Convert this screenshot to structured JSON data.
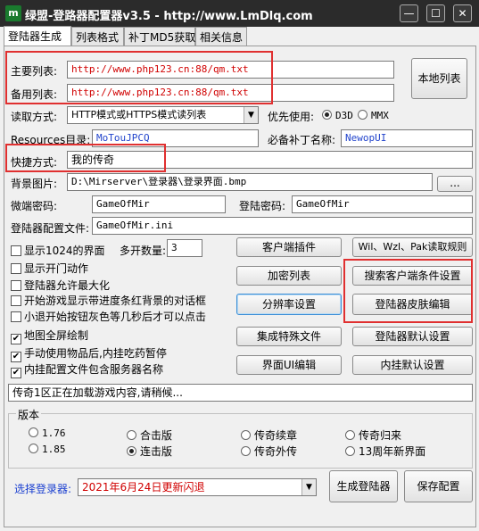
{
  "window": {
    "title": "绿盟-登路器配置器v3.5 - http://www.LmDlq.com",
    "icon_letter": "m",
    "minimize": "—",
    "maximize": "☐",
    "close": "✕"
  },
  "tabs": [
    {
      "label": "登陆器生成"
    },
    {
      "label": "列表格式"
    },
    {
      "label": "补丁MD5获取"
    },
    {
      "label": "相关信息"
    }
  ],
  "form": {
    "main_list_label": "主要列表:",
    "main_list_value": "http://www.php123.cn:88/qm.txt",
    "backup_list_label": "备用列表:",
    "backup_list_value": "http://www.php123.cn:88/qm.txt",
    "local_list_button": "本地列表",
    "read_mode_label": "读取方式:",
    "read_mode_value": "HTTP模式或HTTPS模式读列表",
    "priority_label": "优先使用:",
    "priority_d3d": "D3D",
    "priority_mmx": "MMX",
    "resources_label": "Resources目录:",
    "resources_value": "MoTouJPCQ",
    "patch_label": "必备补丁名称:",
    "patch_value": "NewopUI",
    "shortcut_label": "快捷方式:",
    "shortcut_value": "我的传奇",
    "bg_label": "背景图片:",
    "bg_value": "D:\\Mirserver\\登录器\\登录界面.bmp",
    "browse_button": "...",
    "micro_pwd_label": "微端密码:",
    "micro_pwd_value": "GameOfMir",
    "login_pwd_label": "登陆密码:",
    "login_pwd_value": "GameOfMir",
    "config_file_label": "登陆器配置文件:",
    "config_file_value": "GameOfMir.ini",
    "multi_count_label": "多开数量:",
    "multi_count_value": "3"
  },
  "checkboxes": [
    {
      "label": "显示1024的界面",
      "checked": false
    },
    {
      "label": "显示开门动作",
      "checked": false
    },
    {
      "label": "登陆器允许最大化",
      "checked": false
    },
    {
      "label": "开始游戏显示带进度条红背景的对话框",
      "checked": false
    },
    {
      "label": "小退开始按钮灰色等几秒后才可以点击",
      "checked": false
    },
    {
      "label": "地图全屏绘制",
      "checked": true
    },
    {
      "label": "手动使用物品后,内挂吃药暂停",
      "checked": true
    },
    {
      "label": "内挂配置文件包含服务器名称",
      "checked": true
    }
  ],
  "buttons": {
    "client_plugin": "客户端插件",
    "wil_rule": "Wil、Wzl、Pak读取规则",
    "encrypt_list": "加密列表",
    "search_client": "搜索客户端条件设置",
    "resolution": "分辨率设置",
    "skin_edit": "登陆器皮肤编辑",
    "special_files": "集成特殊文件",
    "default_settings": "登陆器默认设置",
    "ui_edit": "界面UI编辑",
    "plugin_default": "内挂默认设置"
  },
  "status_text": "传奇1区正在加载游戏内容,请稍候...",
  "version": {
    "title": "版本",
    "options": [
      {
        "label": "1.76",
        "selected": false
      },
      {
        "label": "合击版",
        "selected": false
      },
      {
        "label": "传奇续章",
        "selected": false
      },
      {
        "label": "传奇归来",
        "selected": false
      },
      {
        "label": "1.85",
        "selected": false
      },
      {
        "label": "连击版",
        "selected": true
      },
      {
        "label": "传奇外传",
        "selected": false
      },
      {
        "label": "13周年新界面",
        "selected": false
      }
    ]
  },
  "bottom": {
    "select_label": "选择登录器:",
    "select_value": "2021年6月24日更新闪退",
    "generate_button": "生成登陆器",
    "save_button": "保存配置"
  },
  "colors": {
    "highlight_box": "#e03030",
    "url_text": "#d00000",
    "label_blue": "#1a3fd0"
  }
}
